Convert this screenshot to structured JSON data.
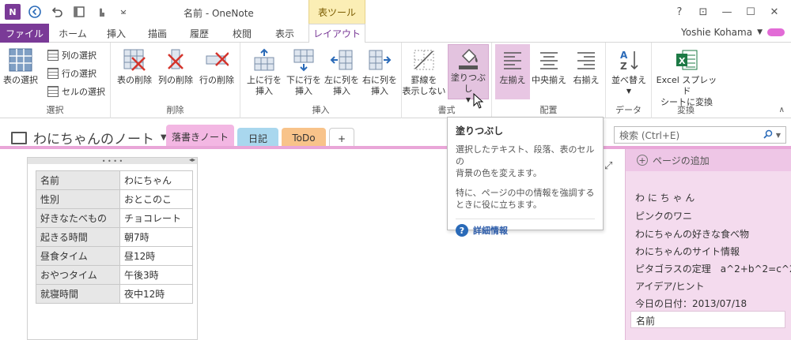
{
  "titlebar": {
    "app_logo": "N",
    "doc_title": "名前 - OneNote",
    "context_tab": "表ツール",
    "help": "?",
    "restore_icon": "⊡",
    "minimize": "—",
    "maximize": "☐",
    "close": "✕"
  },
  "tabs": {
    "file": "ファイル",
    "home": "ホーム",
    "insert": "挿入",
    "draw": "描画",
    "history": "履歴",
    "review": "校閲",
    "view": "表示",
    "layout": "レイアウト"
  },
  "user": {
    "name": "Yoshie Kohama"
  },
  "ribbon": {
    "select_group": {
      "label": "選択",
      "select_table": "表の選択",
      "select_column": "列の選択",
      "select_row": "行の選択",
      "select_cell": "セルの選択"
    },
    "delete_group": {
      "label": "削除",
      "delete_table": "表の削除",
      "delete_column": "列の削除",
      "delete_row": "行の削除"
    },
    "insert_group": {
      "label": "挿入",
      "insert_above_l1": "上に行を",
      "insert_above_l2": "挿入",
      "insert_below_l1": "下に行を",
      "insert_below_l2": "挿入",
      "insert_left_l1": "左に列を",
      "insert_left_l2": "挿入",
      "insert_right_l1": "右に列を",
      "insert_right_l2": "挿入"
    },
    "format_group": {
      "label": "書式",
      "hide_borders_l1": "罫線を",
      "hide_borders_l2": "表示しない",
      "shading": "塗りつぶし"
    },
    "align_group": {
      "label": "配置",
      "left": "左揃え",
      "center": "中央揃え",
      "right": "右揃え"
    },
    "data_group": {
      "label": "データ",
      "sort": "並べ替え"
    },
    "convert_group": {
      "label": "変換",
      "excel_l1": "Excel スプレッド",
      "excel_l2": "シートに変換"
    }
  },
  "notebook": {
    "title": "わにちゃんのノート",
    "sections": [
      {
        "label": "落書きノート",
        "color": "#f3b7e3"
      },
      {
        "label": "日記",
        "color": "#a9d7ee"
      },
      {
        "label": "ToDo",
        "color": "#f8c38a"
      }
    ],
    "add_section": "+"
  },
  "search": {
    "placeholder": "検索 (Ctrl+E)"
  },
  "table": {
    "rows": [
      [
        "名前",
        "わにちゃん"
      ],
      [
        "性別",
        "おとこのこ"
      ],
      [
        "好きなたべもの",
        "チョコレート"
      ],
      [
        "起きる時間",
        "朝7時"
      ],
      [
        "昼食タイム",
        "昼12時"
      ],
      [
        "おやつタイム",
        "午後3時"
      ],
      [
        "就寝時間",
        "夜中12時"
      ]
    ]
  },
  "tooltip": {
    "title": "塗りつぶし",
    "desc1_l1": "選択したテキスト、段落、表のセルの",
    "desc1_l2": "背景の色を変えます。",
    "desc2_l1": "特に、ページの中の情報を強調する",
    "desc2_l2": "ときに役に立ちます。",
    "help_link": "詳細情報"
  },
  "pages": {
    "add_page": "ページの追加",
    "items": [
      "わ に ち ゃ ん",
      "ピンクのワニ",
      "わにちゃんの好きな食べ物",
      "わにちゃんのサイト情報",
      "ピタゴラスの定理　a^2+b^2=c^2",
      "アイデア/ヒント",
      "今日の日付：2013/07/18",
      "名前"
    ]
  },
  "colors": {
    "accent": "#7a3a97",
    "context_tab_bg": "#fbeeb5",
    "page_pane_bg": "#f4dbee",
    "section_line": "#e9a6d8"
  }
}
